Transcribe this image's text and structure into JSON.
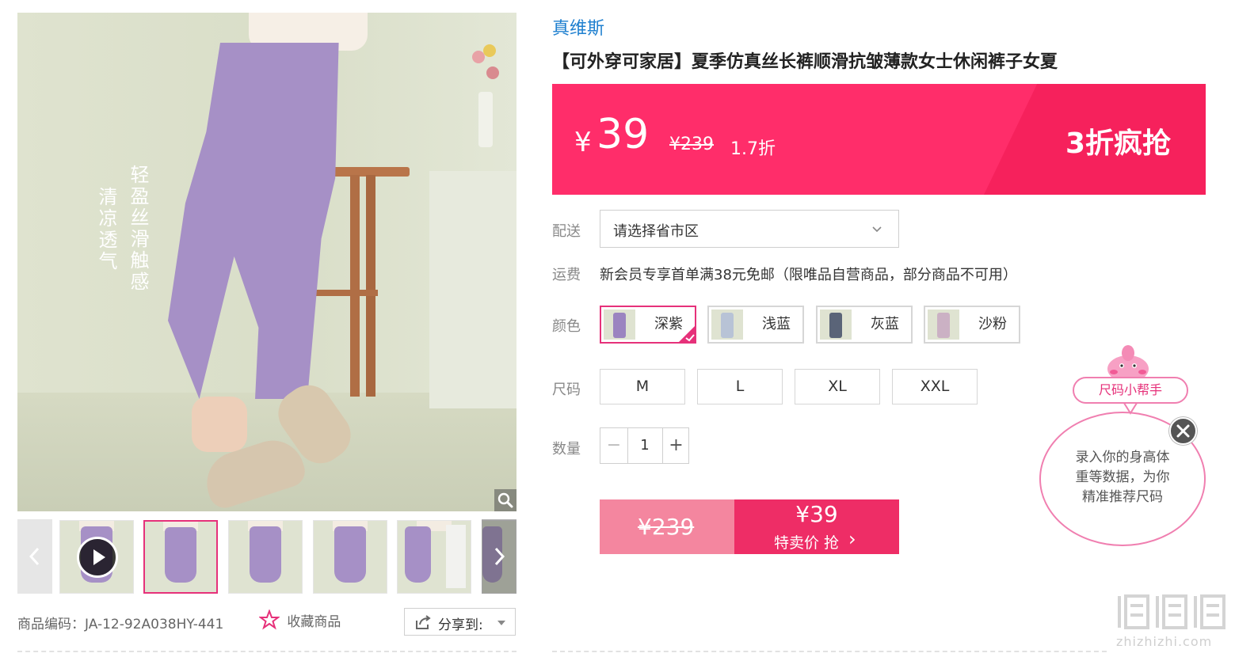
{
  "gallery": {
    "overlay_lines": [
      "轻盈丝滑触感",
      "清凉透气"
    ],
    "thumbnails": [
      {
        "kind": "video",
        "active": false
      },
      {
        "kind": "image",
        "active": true
      },
      {
        "kind": "image",
        "active": false
      },
      {
        "kind": "image",
        "active": false
      },
      {
        "kind": "image",
        "active": false
      },
      {
        "kind": "image",
        "active": false
      }
    ],
    "product_code": "商品编码：JA-12-92A038HY-441",
    "favorite_label": "收藏商品",
    "share_label": "分享到:"
  },
  "product": {
    "brand": "真维斯",
    "title": "【可外穿可家居】夏季仿真丝长裤顺滑抗皱薄款女士休闲裤子女夏",
    "price": {
      "currency": "¥",
      "current": "39",
      "original": "¥239",
      "discount": "1.7折",
      "promo": "3折疯抢"
    },
    "delivery": {
      "label": "配送",
      "placeholder": "请选择省市区"
    },
    "shipping": {
      "label": "运费",
      "text": "新会员专享首单满38元免邮（限唯品自营商品，部分商品不可用）"
    },
    "colors": {
      "label": "颜色",
      "options": [
        {
          "name": "深紫",
          "swatch": "#9b84c0",
          "selected": true
        },
        {
          "name": "浅蓝",
          "swatch": "#b8c3d6",
          "selected": false
        },
        {
          "name": "灰蓝",
          "swatch": "#5a6478",
          "selected": false
        },
        {
          "name": "沙粉",
          "swatch": "#cbb1c4",
          "selected": false
        }
      ]
    },
    "sizes": {
      "label": "尺码",
      "options": [
        "M",
        "L",
        "XL",
        "XXL"
      ]
    },
    "quantity": {
      "label": "数量",
      "value": "1",
      "minus": "−",
      "plus": "+"
    },
    "buy": {
      "original": "¥239",
      "price": "¥39",
      "action": "特卖价 抢",
      "chevron": "›"
    }
  },
  "size_helper": {
    "tag": "尺码小帮手",
    "message_lines": [
      "录入你的身高体",
      "重等数据，为你",
      "精准推荐尺码"
    ]
  },
  "watermark": {
    "text": "zhizhizhi.com"
  },
  "colors": {
    "accent": "#ff2d6a",
    "pink_border": "#e6317a",
    "brand_blue": "#1e7fcf"
  },
  "icons": [
    "play-icon",
    "zoom-icon",
    "chevron-left-icon",
    "chevron-right-icon",
    "star-icon",
    "share-icon",
    "caret-down-icon",
    "close-icon"
  ]
}
